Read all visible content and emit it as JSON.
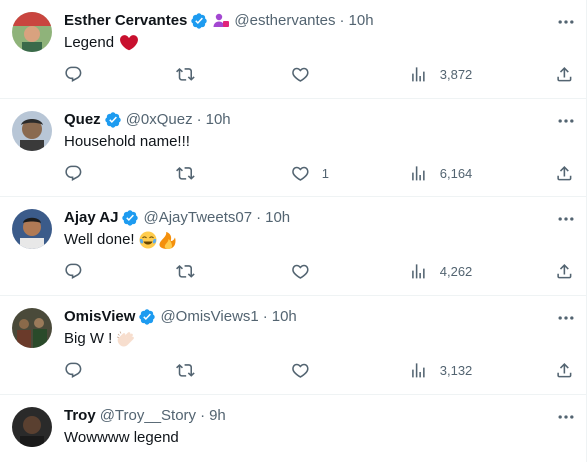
{
  "tweets": [
    {
      "name": "Esther Cervantes",
      "handle": "@esthervantes",
      "time": "10h",
      "text": "Legend",
      "text_emoji": [
        "red-heart"
      ],
      "verified": true,
      "affiliate_icon": "person-badge-icon",
      "replies": "",
      "retweets": "",
      "likes": "",
      "views": "3,872"
    },
    {
      "name": "Quez",
      "handle": "@0xQuez",
      "time": "10h",
      "text": "Household name!!!",
      "text_emoji": [],
      "verified": true,
      "replies": "",
      "retweets": "",
      "likes": "1",
      "views": "6,164"
    },
    {
      "name": "Ajay AJ",
      "handle": "@AjayTweets07",
      "time": "10h",
      "text": "Well done!",
      "text_emoji": [
        "face-with-tears-of-joy",
        "fire"
      ],
      "verified": true,
      "replies": "",
      "retweets": "",
      "likes": "",
      "views": "4,262"
    },
    {
      "name": "OmisView",
      "handle": "@OmisViews1",
      "time": "10h",
      "text": "Big W !",
      "text_emoji": [
        "clapping-hands"
      ],
      "verified": true,
      "replies": "",
      "retweets": "",
      "likes": "",
      "views": "3,132"
    },
    {
      "name": "Troy",
      "handle": "@Troy__Story",
      "time": "9h",
      "text": "Wowwww legend",
      "text_emoji": [],
      "verified": false
    }
  ],
  "colors": {
    "text_primary": "#0f1419",
    "text_secondary": "#536471",
    "verified_blue": "#1d9bf0",
    "divider": "#eff3f4",
    "affiliate_purple": "#a347d1"
  },
  "icons": {
    "reply": "reply-icon",
    "retweet": "retweet-icon",
    "like": "heart-icon",
    "views": "views-chart-icon",
    "share": "share-icon",
    "more": "more-dots-icon",
    "verified": "verified-badge-icon"
  }
}
